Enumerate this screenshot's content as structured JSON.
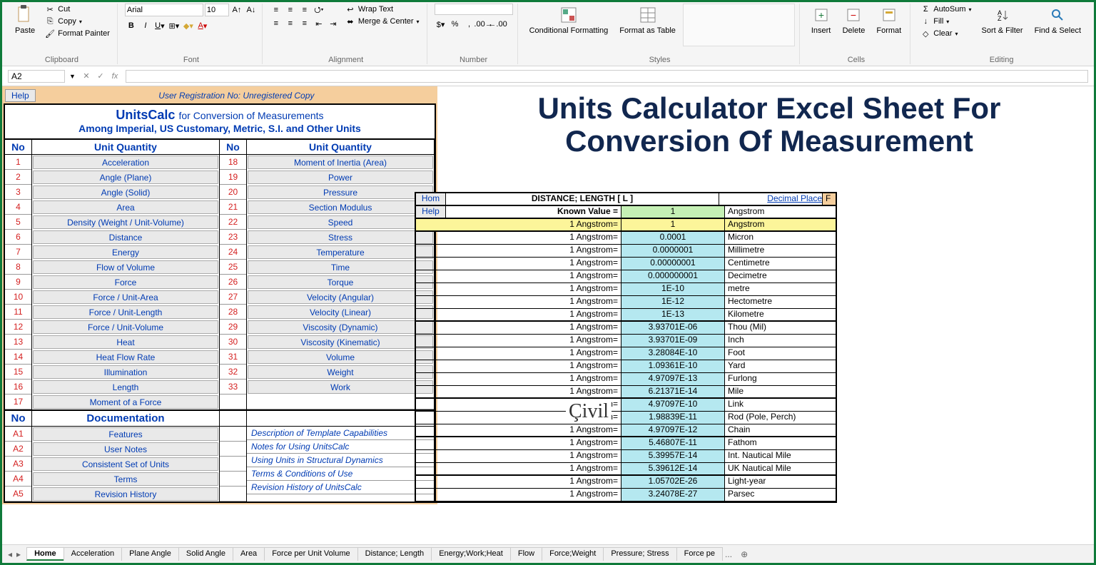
{
  "ribbon": {
    "paste": "Paste",
    "cut": "Cut",
    "copy": "Copy",
    "format_painter": "Format Painter",
    "clipboard_label": "Clipboard",
    "font_name": "Arial",
    "font_size": "10",
    "font_label": "Font",
    "wrap_text": "Wrap Text",
    "merge_center": "Merge & Center",
    "alignment_label": "Alignment",
    "number_label": "Number",
    "cond_format": "Conditional Formatting",
    "format_table": "Format as Table",
    "styles_label": "Styles",
    "insert": "Insert",
    "delete": "Delete",
    "format": "Format",
    "cells_label": "Cells",
    "autosum": "AutoSum",
    "fill": "Fill",
    "clear": "Clear",
    "sort_filter": "Sort & Filter",
    "find_select": "Find & Select",
    "editing_label": "Editing"
  },
  "name_box": "A2",
  "left": {
    "help": "Help",
    "reg": "User Registration No:  Unregistered Copy",
    "title_a": "UnitsCalc",
    "title_b": "for Conversion of Measurements",
    "title2": "Among Imperial, US Customary, Metric, S.I. and Other Units",
    "head_no": "No",
    "head_uq": "Unit Quantity",
    "left_rows": [
      {
        "n": "1",
        "l": "Acceleration"
      },
      {
        "n": "2",
        "l": "Angle (Plane)"
      },
      {
        "n": "3",
        "l": "Angle (Solid)"
      },
      {
        "n": "4",
        "l": "Area"
      },
      {
        "n": "5",
        "l": "Density (Weight / Unit-Volume)"
      },
      {
        "n": "6",
        "l": "Distance"
      },
      {
        "n": "7",
        "l": "Energy"
      },
      {
        "n": "8",
        "l": "Flow of Volume"
      },
      {
        "n": "9",
        "l": "Force"
      },
      {
        "n": "10",
        "l": "Force / Unit-Area"
      },
      {
        "n": "11",
        "l": "Force / Unit-Length"
      },
      {
        "n": "12",
        "l": "Force / Unit-Volume"
      },
      {
        "n": "13",
        "l": "Heat"
      },
      {
        "n": "14",
        "l": "Heat Flow Rate"
      },
      {
        "n": "15",
        "l": "Illumination"
      },
      {
        "n": "16",
        "l": "Length"
      },
      {
        "n": "17",
        "l": "Moment of a Force"
      }
    ],
    "right_rows": [
      {
        "n": "18",
        "l": "Moment of Inertia (Area)"
      },
      {
        "n": "19",
        "l": "Power"
      },
      {
        "n": "20",
        "l": "Pressure"
      },
      {
        "n": "21",
        "l": "Section Modulus"
      },
      {
        "n": "22",
        "l": "Speed"
      },
      {
        "n": "23",
        "l": "Stress"
      },
      {
        "n": "24",
        "l": "Temperature"
      },
      {
        "n": "25",
        "l": "Time"
      },
      {
        "n": "26",
        "l": "Torque"
      },
      {
        "n": "27",
        "l": "Velocity (Angular)"
      },
      {
        "n": "28",
        "l": "Velocity (Linear)"
      },
      {
        "n": "29",
        "l": "Viscosity (Dynamic)"
      },
      {
        "n": "30",
        "l": "Viscosity (Kinematic)"
      },
      {
        "n": "31",
        "l": "Volume"
      },
      {
        "n": "32",
        "l": "Weight"
      },
      {
        "n": "33",
        "l": "Work"
      }
    ],
    "doc_head": "Documentation",
    "doc_rows": [
      {
        "n": "A1",
        "l": "Features",
        "d": "Description of Template Capabilities"
      },
      {
        "n": "A2",
        "l": "User Notes",
        "d": "Notes for Using UnitsCalc"
      },
      {
        "n": "A3",
        "l": "Consistent Set of Units",
        "d": "Using Units in Structural Dynamics"
      },
      {
        "n": "A4",
        "l": "Terms",
        "d": "Terms & Conditions of Use"
      },
      {
        "n": "A5",
        "l": "Revision History",
        "d": "Revision History of UnitsCalc"
      }
    ]
  },
  "right_title_1": "Units Calculator Excel Sheet For",
  "right_title_2": "Conversion Of Measurement",
  "conv": {
    "hom": "Hom",
    "help": "Help",
    "header": "DISTANCE; LENGTH [ L ]",
    "decimal": "Decimal Place",
    "f": "F",
    "known_label": "Known Value =",
    "known_val": "1",
    "known_unit": "Angstrom",
    "rows": [
      {
        "label": "1 Angstrom=",
        "val": "1",
        "unit": "Angstrom",
        "bg": "yellow",
        "thick": true
      },
      {
        "label": "1 Angstrom=",
        "val": "0.0001",
        "unit": "Micron",
        "bg": "cyan"
      },
      {
        "label": "1 Angstrom=",
        "val": "0.0000001",
        "unit": "Millimetre",
        "bg": "cyan"
      },
      {
        "label": "1 Angstrom=",
        "val": "0.00000001",
        "unit": "Centimetre",
        "bg": "cyan"
      },
      {
        "label": "1 Angstrom=",
        "val": "0.000000001",
        "unit": "Decimetre",
        "bg": "cyan"
      },
      {
        "label": "1 Angstrom=",
        "val": "1E-10",
        "unit": "metre",
        "bg": "cyan"
      },
      {
        "label": "1 Angstrom=",
        "val": "1E-12",
        "unit": "Hectometre",
        "bg": "cyan"
      },
      {
        "label": "1 Angstrom=",
        "val": "1E-13",
        "unit": "Kilometre",
        "bg": "cyan",
        "thick": true
      },
      {
        "label": "1 Angstrom=",
        "val": "3.93701E-06",
        "unit": "Thou (Mil)",
        "bg": "cyan"
      },
      {
        "label": "1 Angstrom=",
        "val": "3.93701E-09",
        "unit": "Inch",
        "bg": "cyan"
      },
      {
        "label": "1 Angstrom=",
        "val": "3.28084E-10",
        "unit": "Foot",
        "bg": "cyan"
      },
      {
        "label": "1 Angstrom=",
        "val": "1.09361E-10",
        "unit": "Yard",
        "bg": "cyan"
      },
      {
        "label": "1 Angstrom=",
        "val": "4.97097E-13",
        "unit": "Furlong",
        "bg": "cyan"
      },
      {
        "label": "1 Angstrom=",
        "val": "6.21371E-14",
        "unit": "Mile",
        "bg": "cyan",
        "thick": true
      },
      {
        "label": "1 Angstrom=",
        "val": "4.97097E-10",
        "unit": "Link",
        "bg": "cyan"
      },
      {
        "label": "1 Angstrom=",
        "val": "1.98839E-11",
        "unit": "Rod (Pole, Perch)",
        "bg": "cyan"
      },
      {
        "label": "1 Angstrom=",
        "val": "4.97097E-12",
        "unit": "Chain",
        "bg": "cyan",
        "thick": true
      },
      {
        "label": "1 Angstrom=",
        "val": "5.46807E-11",
        "unit": "Fathom",
        "bg": "cyan"
      },
      {
        "label": "1 Angstrom=",
        "val": "5.39957E-14",
        "unit": "Int. Nautical Mile",
        "bg": "cyan"
      },
      {
        "label": "1 Angstrom=",
        "val": "5.39612E-14",
        "unit": "UK Nautical Mile",
        "bg": "cyan",
        "thick": true
      },
      {
        "label": "1 Angstrom=",
        "val": "1.05702E-26",
        "unit": "Light-year",
        "bg": "cyan"
      },
      {
        "label": "1 Angstrom=",
        "val": "3.24078E-27",
        "unit": "Parsec",
        "bg": "cyan"
      }
    ]
  },
  "watermark": "Çivil",
  "tabs": [
    "Home",
    "Acceleration",
    "Plane Angle",
    "Solid Angle",
    "Area",
    "Force per Unit Volume",
    "Distance; Length",
    "Energy;Work;Heat",
    "Flow",
    "Force;Weight",
    "Pressure; Stress",
    "Force pe"
  ],
  "tabs_active": 0
}
